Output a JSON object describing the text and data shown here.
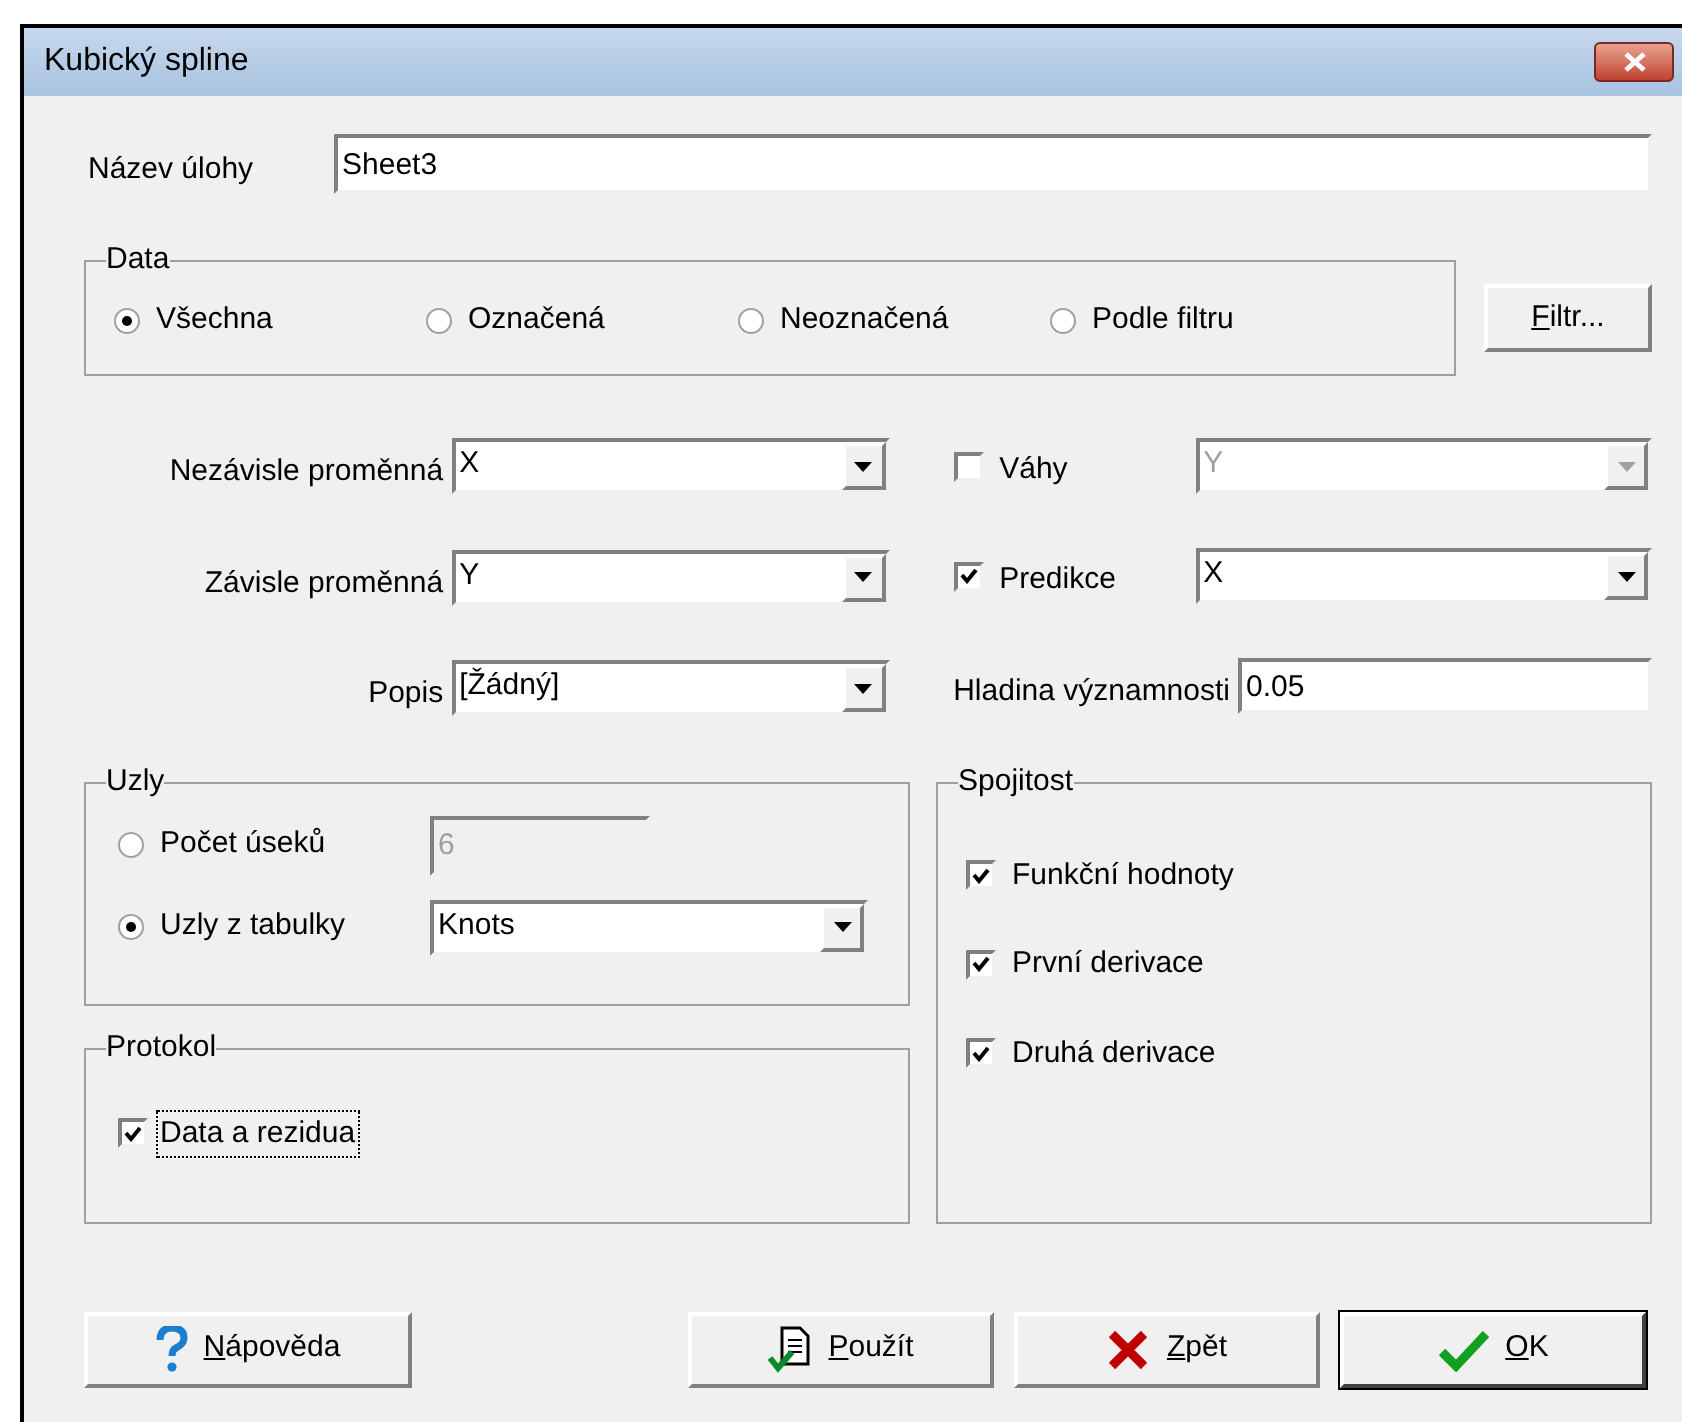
{
  "window": {
    "title": "Kubický spline"
  },
  "task_name": {
    "label": "Název úlohy",
    "value": "Sheet3"
  },
  "data_group": {
    "title": "Data",
    "options": [
      {
        "label": "Všechna",
        "selected": true
      },
      {
        "label": "Označená",
        "selected": false
      },
      {
        "label": "Neoznačená",
        "selected": false
      },
      {
        "label": "Podle filtru",
        "selected": false
      }
    ],
    "filter_button": "Filtr..."
  },
  "left_fields": [
    {
      "label": "Nezávisle proměnná",
      "value": "X"
    },
    {
      "label": "Závisle proměnná",
      "value": "Y"
    },
    {
      "label": "Popis",
      "value": "[Žádný]"
    }
  ],
  "right_fields": [
    {
      "kind": "check_combo",
      "label": "Váhy",
      "checked": false,
      "value": "Y",
      "disabled": true
    },
    {
      "kind": "check_combo",
      "label": "Predikce",
      "checked": true,
      "value": "X",
      "disabled": false
    },
    {
      "kind": "text",
      "label": "Hladina významnosti",
      "value": "0.05"
    }
  ],
  "knots_group": {
    "title": "Uzly",
    "options": [
      {
        "kind": "count",
        "label": "Počet úseků",
        "selected": false,
        "value": "6"
      },
      {
        "kind": "table",
        "label": "Uzly z tabulky",
        "selected": true,
        "value": "Knots"
      }
    ]
  },
  "protocol_group": {
    "title": "Protokol",
    "items": [
      {
        "label": "Data a rezidua",
        "checked": true,
        "focused": true
      }
    ]
  },
  "continuity_group": {
    "title": "Spojitost",
    "items": [
      {
        "label": "Funkční hodnoty",
        "checked": true
      },
      {
        "label": "První derivace",
        "checked": true
      },
      {
        "label": "Druhá derivace",
        "checked": true
      }
    ]
  },
  "buttons": [
    {
      "kind": "help",
      "label": "Nápověda"
    },
    {
      "kind": "apply",
      "label": "Použít"
    },
    {
      "kind": "cancel",
      "label": "Zpět"
    },
    {
      "kind": "ok",
      "label": "OK",
      "default": true
    }
  ]
}
